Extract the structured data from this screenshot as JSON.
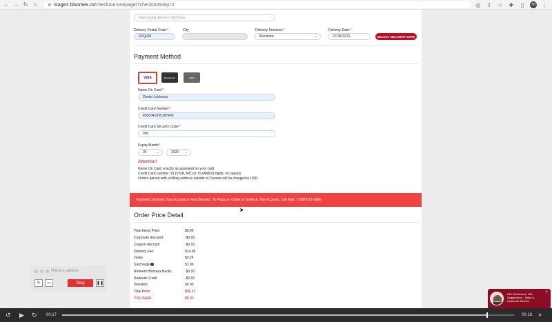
{
  "browser": {
    "url_host": "stage2.bloomex.ca",
    "url_path": "/checkout-onepage/?checkoutStep=2",
    "profile_initials": "ЭВ"
  },
  "delivery": {
    "city_town_placeholder": "Start typing delivery City/Town",
    "postal_code_label": "Delivery Postal Code:",
    "postal_code_value": "R1Q2J8",
    "city_label": "City",
    "province_label": "Delivery Province:",
    "province_value": "Manitoba",
    "date_label": "Delivery Date:",
    "date_value": "07/08/2023",
    "select_date_button": "SELECT DELIVERY DATE"
  },
  "payment": {
    "title": "Payment Method",
    "cards": [
      "VISA",
      "MasterCard",
      "AMEX"
    ],
    "name_label": "Name On Card:",
    "name_value": "Dimitri Lokhonia",
    "number_label": "Credit Card Number:",
    "number_value": "4500041055187406",
    "cvv_label": "Credit Card Security Code:",
    "cvv_value": "000",
    "expiry_label": "Expiry Month:",
    "expiry_month": "05",
    "expiry_year": "2025",
    "attention_title": "Attention!",
    "notes": [
      "Name On Card: exactly as appeared on your card",
      "Credit Card number: 16 (VISA, MC) or 15 (AMEX) digits, no spaces",
      "Orders placed with a billing address outside of Canada will be charged in USD."
    ]
  },
  "error_banner": "Payment Declined. Your Account is Now Blocked. To Place an Order or Unblock Your Account, Call Now: 1-888-912-5666.",
  "order": {
    "title": "Order Price Detail",
    "rows": [
      {
        "label": "Total Items Price:",
        "value": "$9.99"
      },
      {
        "label": "Corporate discount",
        "value": "-$0.00"
      },
      {
        "label": "Coupon discount",
        "value": "-$0.00"
      },
      {
        "label": "Delivery Fee:",
        "value": "$14.99"
      },
      {
        "label": "Taxes",
        "value": "$3.24"
      },
      {
        "label": "Surcharge",
        "value": "$1.99"
      },
      {
        "label": "Redeem Bloomex Bucks",
        "value": "-$0.00"
      },
      {
        "label": "Redeem Credit",
        "value": "-$0.00"
      },
      {
        "label": "Donation",
        "value": "$0.00"
      },
      {
        "label": "Total Price:",
        "value": "$30.21"
      },
      {
        "label": "YOU SAVE:",
        "value": "$5.00"
      }
    ]
  },
  "recorder": {
    "title": "Начать запись",
    "stop_label": "Stop"
  },
  "chat": {
    "text": "24/7 Assistance: Gift Suggestions - Sales & Customer Service",
    "close": "×"
  },
  "video": {
    "current_time": "00:17",
    "total_time": "00:18",
    "progress": 0.94
  }
}
